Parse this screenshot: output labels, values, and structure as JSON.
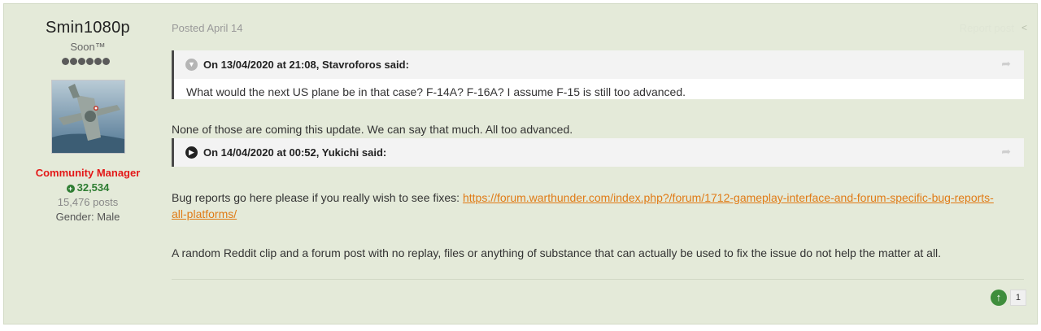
{
  "author": {
    "name": "Smin1080p",
    "title": "Soon™",
    "group": "Community Manager",
    "reputation": "32,534",
    "post_count": "15,476 posts",
    "gender": "Gender: Male",
    "rank_pips": 6
  },
  "post": {
    "date": "Posted April 14",
    "report_label": "Report post",
    "quotes": [
      {
        "citation": "On 13/04/2020 at 21:08, Stavroforos said:",
        "body": "What would the next US plane be in that case? F-14A? F-16A? I assume F-15 is still too advanced.",
        "expanded": true
      },
      {
        "citation": "On 14/04/2020 at 00:52, Yukichi said:",
        "body": "",
        "expanded": false
      }
    ],
    "paragraph_1": "None of those are coming this update. We can say that much. All too advanced.",
    "paragraph_2_prefix": "Bug reports go here please if you really wish to see fixes: ",
    "link_line_1": "https://forum.warthunder.com/index.php?/forum/1712-gameplay-interface-and-forum-specific-bug-reports-",
    "link_line_2": "all-platforms/",
    "paragraph_3": "A random Reddit clip and a forum post with no replay, files or anything of substance that can actually be used to fix the issue do not help the matter at all.",
    "upvotes": "1"
  },
  "colors": {
    "post_background": "#e4ead9",
    "group_red": "#e31818",
    "reputation_green": "#2e7d32",
    "link_orange": "#e07b16"
  },
  "icons": {
    "rep": "plus-circle-icon",
    "collapse": "chevron-down-icon",
    "expand": "chevron-right-icon",
    "quote_jump": "share-arrow-icon",
    "upvote": "arrow-up-icon"
  }
}
